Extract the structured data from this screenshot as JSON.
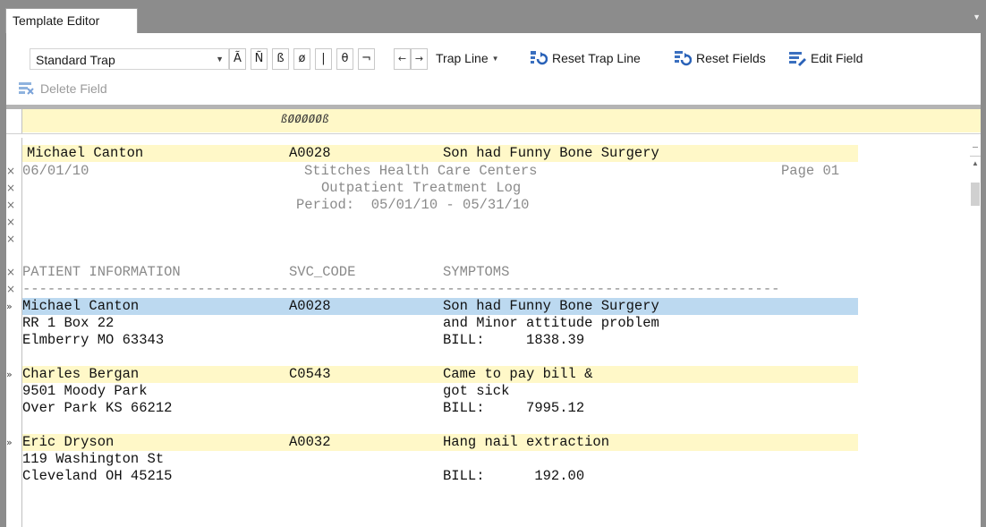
{
  "window": {
    "tab_title": "Template Editor"
  },
  "toolbar": {
    "trap_type": "Standard Trap",
    "symbols": [
      "Ã",
      "Ñ",
      "ß",
      "ø",
      "|",
      "θ",
      "¬"
    ],
    "arrow_left": "←",
    "arrow_right": "→",
    "trap_line_label": "Trap Line",
    "reset_trap_line_label": "Reset Trap Line",
    "reset_fields_label": "Reset Fields",
    "edit_field_label": "Edit Field",
    "delete_field_label": "Delete Field"
  },
  "ruler": {
    "pattern": "ßØØØØØß"
  },
  "trap_header": {
    "name": "Michael Canton",
    "code": "A0028",
    "symptom": "Son had Funny Bone Surgery"
  },
  "report_header": {
    "date": "06/01/10",
    "company": "Stitches Health Care Centers",
    "page": "Page 01",
    "subtitle": "Outpatient Treatment Log",
    "period": "Period:  05/01/10 - 05/31/10",
    "col_patient": "PATIENT INFORMATION",
    "col_svc": "SVC_CODE",
    "col_symptoms": "SYMPTOMS",
    "rule": "-------------------------------------------------------------------------------------------"
  },
  "records": [
    {
      "name": "Michael Canton",
      "code": "A0028",
      "symptom1": "Son had Funny Bone Surgery",
      "address": "RR 1 Box 22",
      "symptom2": "and Minor attitude problem",
      "city": "Elmberry MO 63343",
      "bill": "BILL:     1838.39"
    },
    {
      "name": "Charles Bergan",
      "code": "C0543",
      "symptom1": "Came to pay bill &",
      "address": "9501 Moody Park",
      "symptom2": "got sick",
      "city": "Over Park KS 66212",
      "bill": "BILL:     7995.12"
    },
    {
      "name": "Eric Dryson",
      "code": "A0032",
      "symptom1": "Hang nail extraction",
      "address": "119 Washington St",
      "symptom2": "",
      "city": "Cleveland OH 45215",
      "bill": "BILL:      192.00"
    }
  ],
  "colors": {
    "trap_highlight": "#fff8c8",
    "selected_highlight": "#bcd9f0",
    "frame": "#8c8c8c"
  }
}
